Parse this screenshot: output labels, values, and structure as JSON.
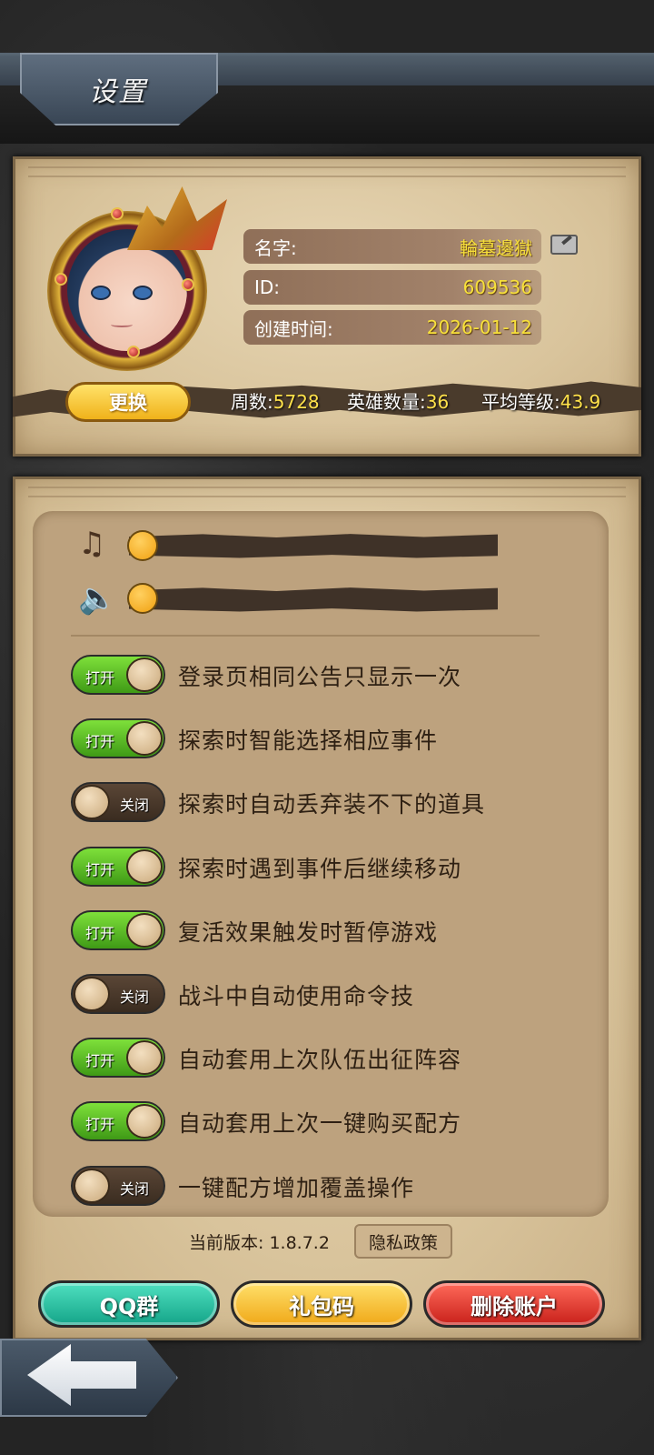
{
  "header": {
    "title": "设置"
  },
  "profile": {
    "name_label": "名字:",
    "name_value": "輪墓邊獄",
    "id_label": "ID:",
    "id_value": "609536",
    "created_label": "创建时间:",
    "created_value": "2026-01-12",
    "change_button": "更换"
  },
  "stats": {
    "weeks_label": "周数:",
    "weeks_value": "5728",
    "heroes_label": "英雄数量:",
    "heroes_value": "36",
    "avg_level_label": "平均等级:",
    "avg_level_value": "43.9"
  },
  "audio": {
    "music_icon": "music-note-icon",
    "sound_icon": "speaker-icon",
    "music_volume": 0,
    "sound_volume": 0
  },
  "toggles": [
    {
      "label": "登录页相同公告只显示一次",
      "state": "打开"
    },
    {
      "label": "探索时智能选择相应事件",
      "state": "打开"
    },
    {
      "label": "探索时自动丢弃装不下的道具",
      "state": "关闭"
    },
    {
      "label": "探索时遇到事件后继续移动",
      "state": "打开"
    },
    {
      "label": "复活效果触发时暂停游戏",
      "state": "打开"
    },
    {
      "label": "战斗中自动使用命令技",
      "state": "关闭"
    },
    {
      "label": "自动套用上次队伍出征阵容",
      "state": "打开"
    },
    {
      "label": "自动套用上次一键购买配方",
      "state": "打开"
    },
    {
      "label": "一键配方增加覆盖操作",
      "state": "关闭"
    }
  ],
  "footer": {
    "version_text": "当前版本: 1.8.7.2",
    "privacy_button": "隐私政策",
    "qq_button": "QQ群",
    "gift_button": "礼包码",
    "delete_button": "删除账户"
  },
  "colors": {
    "toggle_on": "#4fb81c",
    "toggle_off": "#4a3828",
    "value_highlight": "#f7e03a",
    "parchment": "#d9c49c"
  }
}
